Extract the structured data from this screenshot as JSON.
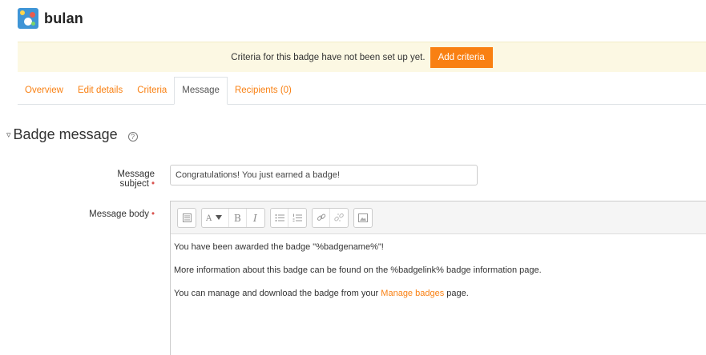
{
  "header": {
    "title": "bulan",
    "badge_icon": "badge-image"
  },
  "alert": {
    "text": "Criteria for this badge have not been set up yet.",
    "button_label": "Add criteria",
    "bg_color": "#fcf8e3",
    "button_color": "#f98012"
  },
  "tabs": [
    {
      "label": "Overview",
      "active": false
    },
    {
      "label": "Edit details",
      "active": false
    },
    {
      "label": "Criteria",
      "active": false
    },
    {
      "label": "Message",
      "active": true
    },
    {
      "label": "Recipients (0)",
      "active": false
    }
  ],
  "section": {
    "title": "Badge message",
    "collapse_icon": "▿",
    "help_icon": "?"
  },
  "form": {
    "subject_label": "Message subject",
    "subject_value": "Congratulations! You just earned a badge!",
    "body_label": "Message body",
    "required_marker": "•"
  },
  "editor": {
    "toolbar_icons": [
      "toolbar-toggle-icon",
      "paragraph-style-icon",
      "bold-icon",
      "italic-icon",
      "unordered-list-icon",
      "ordered-list-icon",
      "link-icon",
      "unlink-icon",
      "image-icon"
    ],
    "line1": "You have been awarded the badge \"%badgename%\"!",
    "line2": "More information about this badge can be found on the %badgelink% badge information page.",
    "line3_prefix": "You can manage and download the badge from your",
    "line3_link": "Manage badges",
    "line3_suffix": "page."
  },
  "colors": {
    "accent": "#f98012",
    "required": "#d9534f"
  }
}
